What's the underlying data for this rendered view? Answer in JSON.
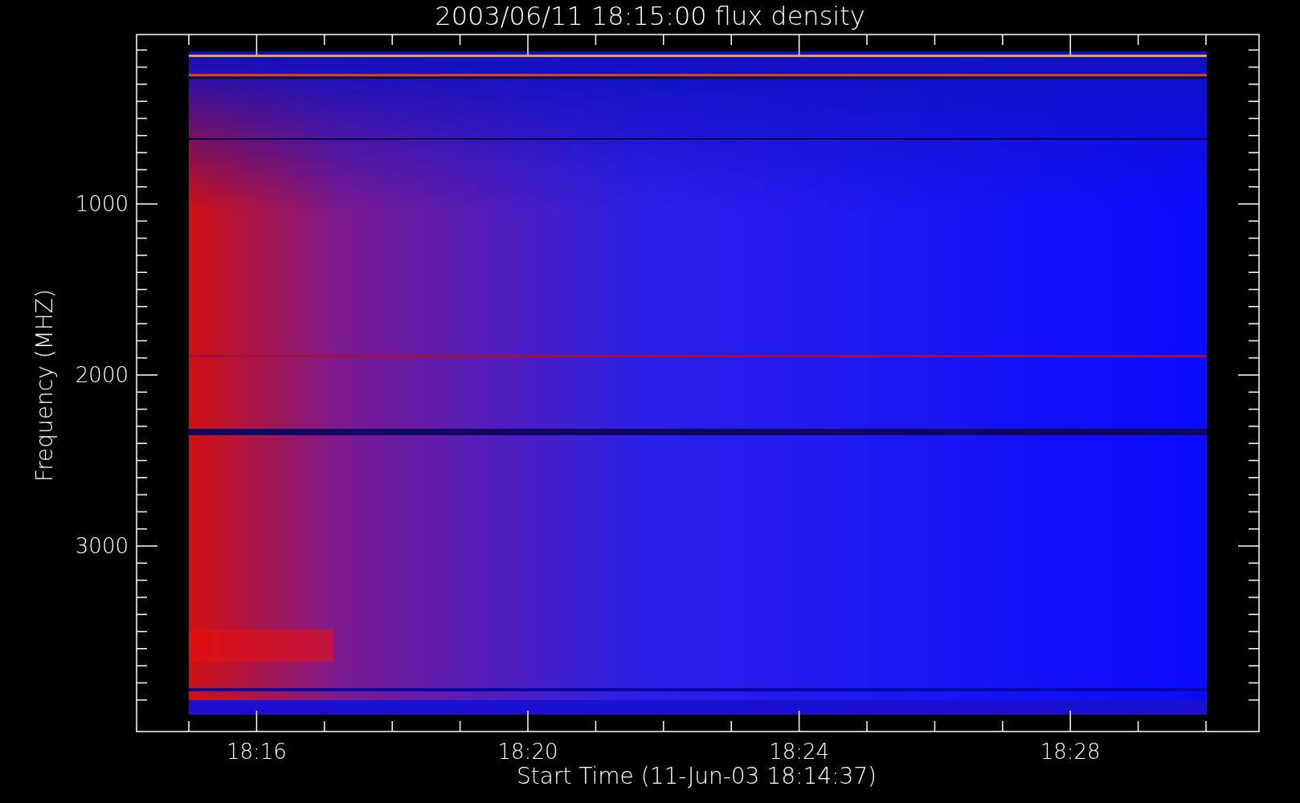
{
  "plot": {
    "title": "2003/06/11 18:15:00 flux density",
    "x_axis": {
      "label": "Start Time (11-Jun-03 18:14:37)",
      "ticks": [
        "18:16",
        "18:20",
        "18:24",
        "18:28"
      ]
    },
    "y_axis": {
      "label": "Frequency (MHZ)",
      "ticks": [
        "1000",
        "2000",
        "3000"
      ]
    }
  }
}
